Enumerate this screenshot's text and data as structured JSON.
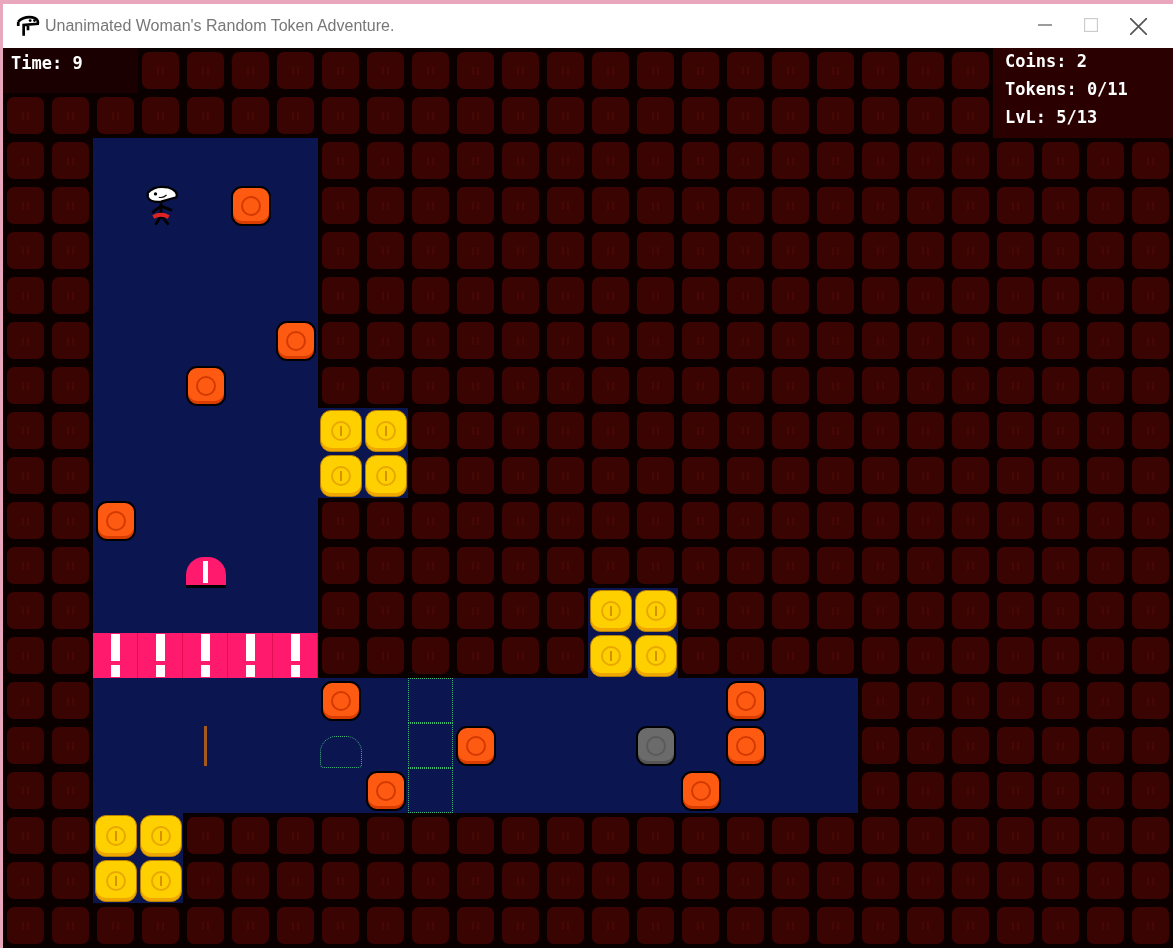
{
  "window": {
    "title": "Unanimated Woman's Random Token Adventure."
  },
  "hud": {
    "time": "Time: 9",
    "coins": "Coins: 2",
    "tokens": "Tokens: 0/11",
    "level": "LvL: 5/13"
  }
}
